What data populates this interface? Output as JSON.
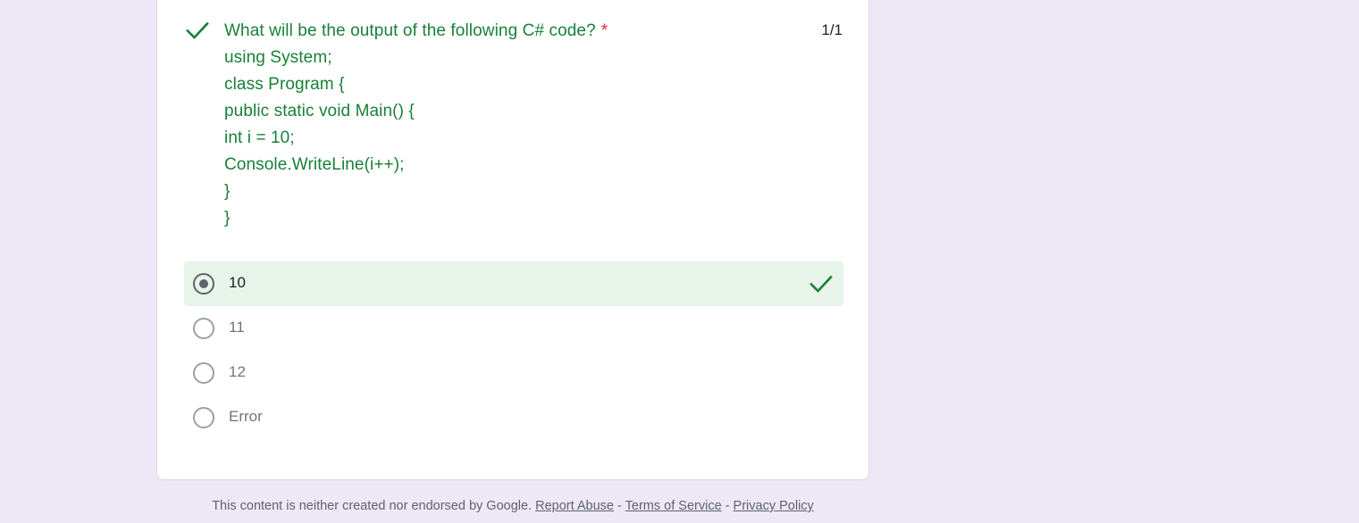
{
  "question": {
    "title": "What will be the output of the following C# code?",
    "required_marker": "*",
    "code_lines": [
      "using System;",
      "class Program {",
      "public static void Main() {",
      "int i = 10;",
      "Console.WriteLine(i++);",
      "}",
      "}"
    ],
    "score": "1/1",
    "status_icon": "check-icon"
  },
  "options": [
    {
      "label": "10",
      "selected": true,
      "correct": true
    },
    {
      "label": "11",
      "selected": false,
      "correct": false
    },
    {
      "label": "12",
      "selected": false,
      "correct": false
    },
    {
      "label": "Error",
      "selected": false,
      "correct": false
    }
  ],
  "footer": {
    "text": "This content is neither created nor endorsed by Google.",
    "report_abuse": "Report Abuse",
    "terms": "Terms of Service",
    "privacy": "Privacy Policy",
    "separator": "-"
  },
  "colors": {
    "background": "#ede7f6",
    "correct_green": "#188038",
    "selected_bg": "#e6f4ea",
    "required_red": "#d93025"
  }
}
